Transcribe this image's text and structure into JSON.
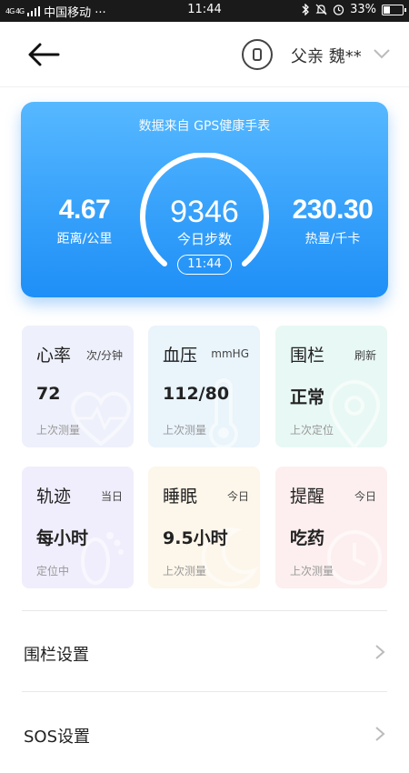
{
  "status_bar": {
    "network": "4G 4G",
    "carrier": "中国移动 ···",
    "time": "11:44",
    "icons": [
      "bluetooth-icon",
      "silent-icon",
      "alarm-icon"
    ],
    "battery": "33%",
    "battery_level": 0.33
  },
  "header": {
    "back_icon": "back-arrow-icon",
    "device_icon": "watch-icon",
    "user": "父亲 魏**",
    "dropdown_icon": "chevron-down-icon"
  },
  "summary": {
    "source": "数据来自 GPS健康手表",
    "distance_value": "4.67",
    "distance_label": "距离/公里",
    "steps_value": "9346",
    "steps_label": "今日步数",
    "time": "11:44",
    "calories_value": "230.30",
    "calories_label": "热量/千卡",
    "colors": {
      "gradient_top": "#56b8ff",
      "gradient_bottom": "#1e8ff7"
    }
  },
  "tiles": [
    {
      "title": "心率",
      "unit": "次/分钟",
      "value": "72",
      "sub": "上次测量",
      "icon": "heart-icon"
    },
    {
      "title": "血压",
      "unit": "mmHG",
      "value": "112/80",
      "sub": "上次测量",
      "icon": "thermometer-icon"
    },
    {
      "title": "围栏",
      "unit": "刷新",
      "value": "正常",
      "sub": "上次定位",
      "icon": "location-pin-icon"
    },
    {
      "title": "轨迹",
      "unit": "当日",
      "value": "每小时",
      "sub": "定位中",
      "icon": "footprint-icon"
    },
    {
      "title": "睡眠",
      "unit": "今日",
      "value": "9.5小时",
      "sub": "上次测量",
      "icon": "moon-icon"
    },
    {
      "title": "提醒",
      "unit": "今日",
      "value": "吃药",
      "sub": "上次测量",
      "icon": "clock-icon"
    }
  ],
  "list": [
    {
      "label": "围栏设置",
      "icon": "chevron-right-icon"
    },
    {
      "label": "SOS设置",
      "icon": "chevron-right-icon"
    }
  ]
}
